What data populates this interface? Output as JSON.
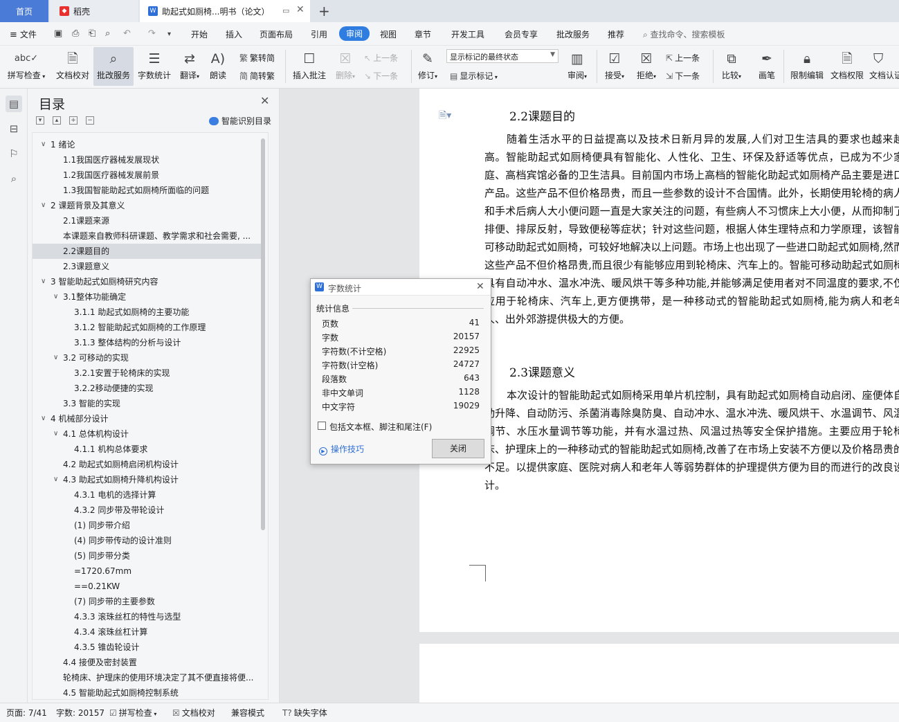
{
  "tabs": {
    "home": "首页",
    "daoke": "稻壳",
    "doc": "助起式如厕椅...明书（论文）"
  },
  "menu": {
    "file": "文件",
    "items": [
      "开始",
      "插入",
      "页面布局",
      "引用",
      "审阅",
      "视图",
      "章节",
      "开发工具",
      "会员专享",
      "批改服务",
      "推荐"
    ],
    "search_placeholder": "查找命令、搜索模板"
  },
  "ribbon": {
    "spell": "拼写检查",
    "proof": "文档校对",
    "correct": "批改服务",
    "wordcount": "字数统计",
    "translate": "翻译",
    "read": "朗读",
    "t2s": "繁转简",
    "s2t": "简转繁",
    "insert_comment": "插入批注",
    "delete": "删除",
    "prev_comment": "上一条",
    "next_comment": "下一条",
    "revise": "修订",
    "markup_state": "显示标记的最终状态",
    "show_markup": "显示标记",
    "review": "审阅",
    "accept": "接受",
    "reject": "拒绝",
    "prev_change": "上一条",
    "next_change": "下一条",
    "compare": "比较",
    "pen": "画笔",
    "restrict": "限制编辑",
    "permission": "文档权限",
    "certify": "文档认证"
  },
  "nav": {
    "title": "目录",
    "smart_toc": "智能识别目录",
    "items": [
      {
        "text": "1 绪论",
        "level": 1,
        "expand": true
      },
      {
        "text": "1.1我国医疗器械发展现状",
        "level": 2
      },
      {
        "text": "1.2我国医疗器械发展前景",
        "level": 2
      },
      {
        "text": "1.3我国智能助起式如厕椅所面临的问题",
        "level": 2
      },
      {
        "text": "2 课题背景及其意义",
        "level": 1,
        "expand": true
      },
      {
        "text": "2.1课题来源",
        "level": 2
      },
      {
        "text": "本课题来自教师科研课题、教学需求和社会需要, ...",
        "level": 2
      },
      {
        "text": "2.2课题目的",
        "level": 2,
        "selected": true
      },
      {
        "text": "2.3课题意义",
        "level": 2
      },
      {
        "text": "3 智能助起式如厕椅研究内容",
        "level": 1,
        "expand": true
      },
      {
        "text": "3.1整体功能确定",
        "level": 2,
        "expand": true
      },
      {
        "text": "3.1.1 助起式如厕椅的主要功能",
        "level": 3
      },
      {
        "text": "3.1.2 智能助起式如厕椅的工作原理",
        "level": 3
      },
      {
        "text": "3.1.3 整体结构的分析与设计",
        "level": 3
      },
      {
        "text": "3.2 可移动的实现",
        "level": 2,
        "expand": true
      },
      {
        "text": "3.2.1安置于轮椅床的实现",
        "level": 3
      },
      {
        "text": "3.2.2移动便捷的实现",
        "level": 3
      },
      {
        "text": "3.3 智能的实现",
        "level": 2
      },
      {
        "text": "4 机械部分设计",
        "level": 1,
        "expand": true
      },
      {
        "text": "4.1 总体机构设计",
        "level": 2,
        "expand": true
      },
      {
        "text": "4.1.1 机构总体要求",
        "level": 3
      },
      {
        "text": "4.2 助起式如厕椅启闭机构设计",
        "level": 2
      },
      {
        "text": "4.3 助起式如厕椅升降机构设计",
        "level": 2,
        "expand": true
      },
      {
        "text": "4.3.1 电机的选择计算",
        "level": 3
      },
      {
        "text": "4.3.2 同步带及带轮设计",
        "level": 3
      },
      {
        "text": "(1) 同步带介绍",
        "level": 3
      },
      {
        "text": "(4)   同步带传动的设计准则",
        "level": 3
      },
      {
        "text": "(5)   同步带分类",
        "level": 3
      },
      {
        "text": "=1720.67mm",
        "level": 3
      },
      {
        "text": "==0.21KW",
        "level": 3
      },
      {
        "text": "(7) 同步带的主要参数",
        "level": 3
      },
      {
        "text": "4.3.3 滚珠丝杠的特性与选型",
        "level": 3
      },
      {
        "text": "4.3.4 滚珠丝杠计算",
        "level": 3
      },
      {
        "text": "4.3.5 锥齿轮设计",
        "level": 3
      },
      {
        "text": "4.4 接便及密封装置",
        "level": 2
      },
      {
        "text": "轮椅床、护理床的使用环境决定了其不便直接将便...",
        "level": 2
      },
      {
        "text": "4.5 智能助起式如厕椅控制系统",
        "level": 2
      }
    ]
  },
  "doc": {
    "h_purpose": "2.2课题目的",
    "p_purpose": "随着生活水平的日益提高以及技术日新月异的发展,人们对卫生洁具的要求也越来越高。智能助起式如厕椅便具有智能化、人性化、卫生、环保及舒适等优点，已成为不少家庭、高档宾馆必备的卫生洁具。目前国内市场上高档的智能化助起式如厕椅产品主要是进口产品。这些产品不但价格昂贵，而且一些参数的设计不合国情。此外，长期使用轮椅的病人和手术后病人大小便问题一直是大家关注的问题，有些病人不习惯床上大小便，从而抑制了排便、排尿反射，导致便秘等症状；针对这些问题，根据人体生理特点和力学原理，该智能可移动助起式如厕椅，可较好地解决以上问题。市场上也出现了一些进口助起式如厕椅,然而这些产品不但价格昂贵,而且很少有能够应用到轮椅床、汽车上的。智能可移动助起式如厕椅具有自动冲水、温水冲洗、暖风烘干等多种功能,并能够满足使用者对不同温度的要求,不仅应用于轮椅床、汽车上,更方便携带，是一种移动式的智能助起式如厕椅,能为病人和老年人、出外郊游提供极大的方便。",
    "h_meaning": "2.3课题意义",
    "p_meaning": "本次设计的智能助起式如厕椅采用单片机控制，具有助起式如厕椅自动启闭、座便体自动升降、自动防污、杀菌消毒除臭防臭、自动冲水、温水冲洗、暖风烘干、水温调节、风温调节、水压水量调节等功能，并有水温过热、风温过热等安全保护措施。主要应用于轮椅床、护理床上的一种移动式的智能助起式如厕椅,改善了在市场上安装不方便以及价格昂贵的不足。以提供家庭、医院对病人和老年人等弱势群体的护理提供方便为目的而进行的改良设计。"
  },
  "dialog": {
    "title": "字数统计",
    "group": "统计信息",
    "stats": [
      {
        "label": "页数",
        "value": "41"
      },
      {
        "label": "字数",
        "value": "20157"
      },
      {
        "label": "字符数(不计空格)",
        "value": "22925"
      },
      {
        "label": "字符数(计空格)",
        "value": "24727"
      },
      {
        "label": "段落数",
        "value": "643"
      },
      {
        "label": "非中文单词",
        "value": "1128"
      },
      {
        "label": "中文字符",
        "value": "19029"
      }
    ],
    "include_label": "包括文本框、脚注和尾注(F)",
    "include_checked": false,
    "tips": "操作技巧",
    "close": "关闭"
  },
  "status": {
    "page": "页面: 7/41",
    "words": "字数: 20157",
    "spell": "拼写检查",
    "proof": "文档校对",
    "compat": "兼容模式",
    "missing_font": "缺失字体"
  },
  "colors": {
    "accent": "#2f7de1",
    "home_tab": "#4a7bd6",
    "daoke": "#e8312f"
  }
}
